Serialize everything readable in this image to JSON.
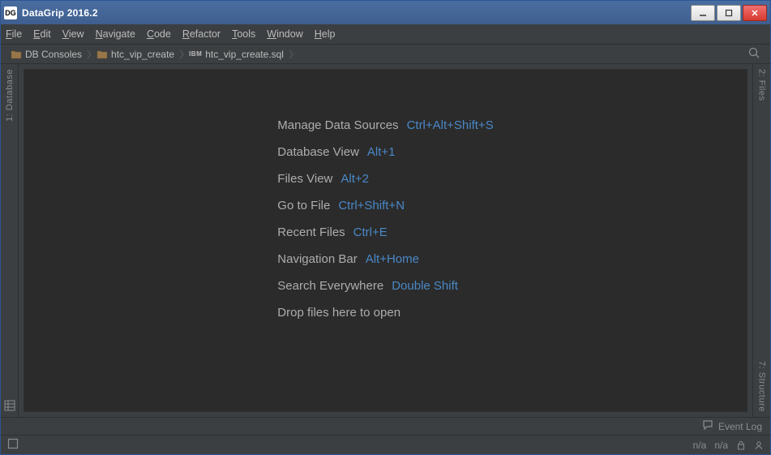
{
  "titlebar": {
    "app_icon_text": "DG",
    "title": "DataGrip 2016.2"
  },
  "menu": {
    "file": "File",
    "edit": "Edit",
    "view": "View",
    "navigate": "Navigate",
    "code": "Code",
    "refactor": "Refactor",
    "tools": "Tools",
    "window": "Window",
    "help": "Help"
  },
  "breadcrumbs": {
    "c0": "DB Consoles",
    "c1": "htc_vip_create",
    "c2": "htc_vip_create.sql",
    "c2_tag": "IBM"
  },
  "side_tools": {
    "left_database": "1: Database",
    "right_files": "2: Files",
    "right_structure": "7: Structure"
  },
  "tips": [
    {
      "label": "Manage Data Sources",
      "shortcut": "Ctrl+Alt+Shift+S"
    },
    {
      "label": "Database View",
      "shortcut": "Alt+1"
    },
    {
      "label": "Files View",
      "shortcut": "Alt+2"
    },
    {
      "label": "Go to File",
      "shortcut": "Ctrl+Shift+N"
    },
    {
      "label": "Recent Files",
      "shortcut": "Ctrl+E"
    },
    {
      "label": "Navigation Bar",
      "shortcut": "Alt+Home"
    },
    {
      "label": "Search Everywhere",
      "shortcut": "Double Shift"
    },
    {
      "label": "Drop files here to open",
      "shortcut": ""
    }
  ],
  "eventlog": {
    "label": "Event Log"
  },
  "status": {
    "pos1": "n/a",
    "pos2": "n/a"
  }
}
